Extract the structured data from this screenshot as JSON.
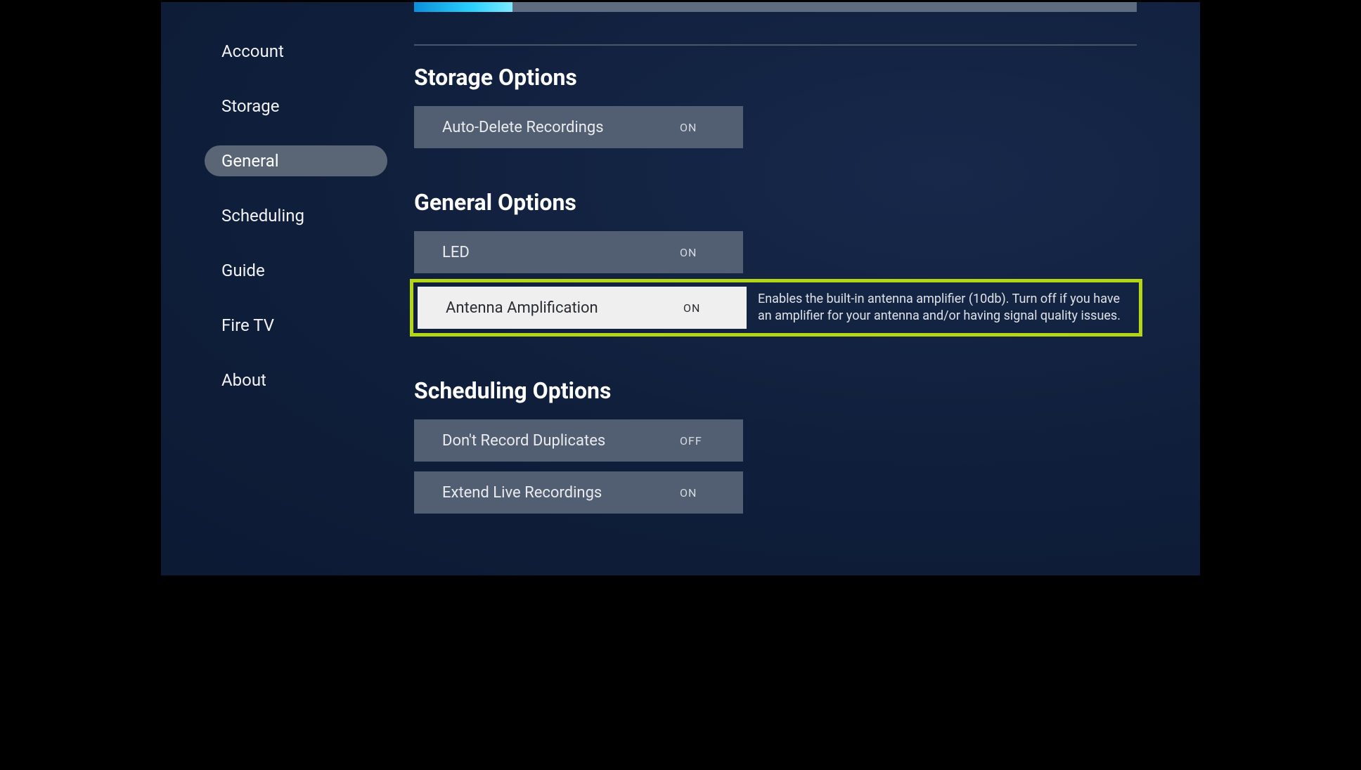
{
  "sidebar": {
    "items": [
      {
        "label": "Account",
        "selected": false
      },
      {
        "label": "Storage",
        "selected": false
      },
      {
        "label": "General",
        "selected": true
      },
      {
        "label": "Scheduling",
        "selected": false
      },
      {
        "label": "Guide",
        "selected": false
      },
      {
        "label": "Fire TV",
        "selected": false
      },
      {
        "label": "About",
        "selected": false
      }
    ]
  },
  "sections": {
    "storage": {
      "title": "Storage Options",
      "auto_delete": {
        "label": "Auto-Delete Recordings",
        "value": "ON"
      }
    },
    "general": {
      "title": "General Options",
      "led": {
        "label": "LED",
        "value": "ON"
      },
      "antenna": {
        "label": "Antenna Amplification",
        "value": "ON",
        "help": "Enables the built-in antenna amplifier (10db).  Turn off if you have an amplifier for your antenna and/or having signal quality issues."
      }
    },
    "scheduling": {
      "title": "Scheduling Options",
      "duplicates": {
        "label": "Don't Record Duplicates",
        "value": "OFF"
      },
      "extend": {
        "label": "Extend Live Recordings",
        "value": "ON"
      }
    }
  }
}
